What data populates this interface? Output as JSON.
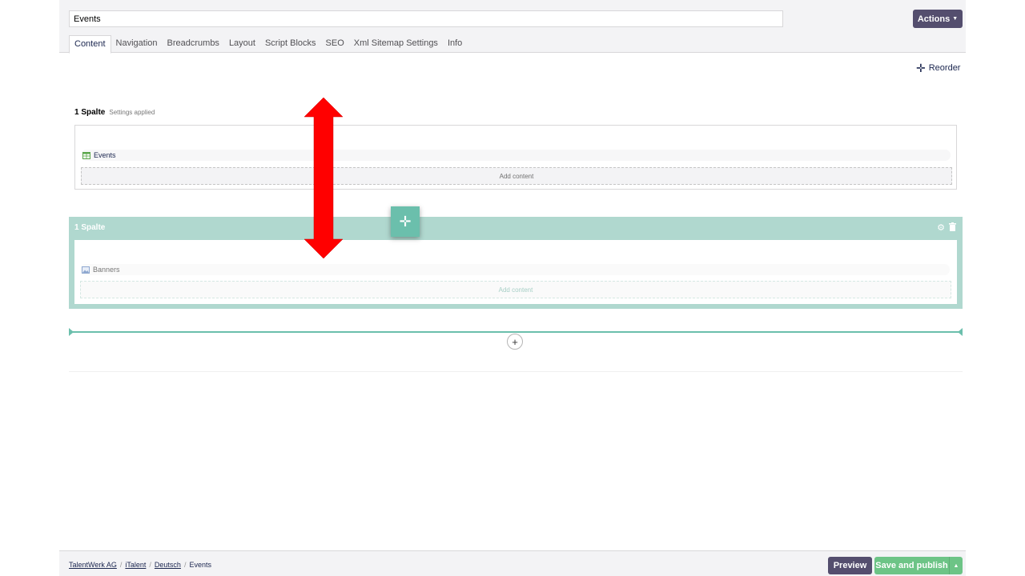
{
  "header": {
    "name_value": "Events",
    "actions_label": "Actions",
    "tabs": [
      {
        "label": "Content",
        "active": true
      },
      {
        "label": "Navigation"
      },
      {
        "label": "Breadcrumbs"
      },
      {
        "label": "Layout"
      },
      {
        "label": "Script Blocks"
      },
      {
        "label": "SEO"
      },
      {
        "label": "Xml Sitemap Settings"
      },
      {
        "label": "Info"
      }
    ]
  },
  "toolbar": {
    "reorder_label": "Reorder"
  },
  "blocks": [
    {
      "title": "1 Spalte",
      "subtitle": "Settings applied",
      "item_label": "Events",
      "item_icon": "grid-icon",
      "add_content_label": "Add content"
    },
    {
      "title": "1 Spalte",
      "item_label": "Banners",
      "item_icon": "image-icon",
      "add_content_label": "Add content",
      "state": "dragging"
    }
  ],
  "footer": {
    "breadcrumb": [
      "TalentWerk AG",
      "iTalent",
      "Deutsch",
      "Events"
    ],
    "preview_label": "Preview",
    "publish_label": "Save and publish"
  },
  "colors": {
    "primary": "#544e6e",
    "success": "#6dc486",
    "drag_accent": "#6bbfac",
    "drag_block": "#b0d8cf",
    "annotation_arrow": "#ff0000"
  }
}
